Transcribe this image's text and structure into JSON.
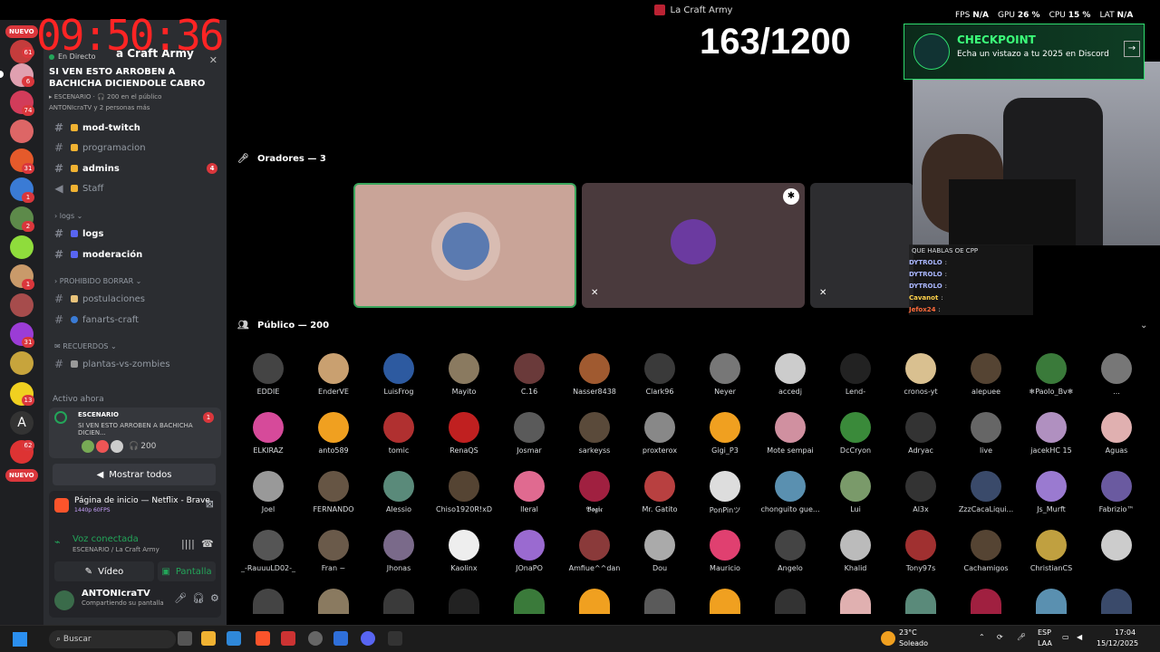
{
  "window": {
    "title": "La Craft Army"
  },
  "overlay": {
    "clock": "09:50:36",
    "counter": "163/1200",
    "perf": {
      "fps_label": "FPS",
      "fps": "N/A",
      "gpu_label": "GPU",
      "gpu": "26 %",
      "cpu_label": "CPU",
      "cpu": "15 %",
      "lat_label": "LAT",
      "lat": "N/A"
    },
    "checkpoint": {
      "title": "CHECKPOINT",
      "subtitle": "Echa un vistazo a tu 2025 en Discord"
    },
    "chat": [
      {
        "user": "",
        "msg": "QUE HABLAS OE CPP"
      },
      {
        "user": "DYTROLO",
        "msg": ":"
      },
      {
        "user": "DYTROLO",
        "msg": ":"
      },
      {
        "user": "DYTROLO",
        "msg": ":"
      },
      {
        "user": "Cavanot",
        "msg": ":"
      },
      {
        "user": "Jefox24",
        "msg": ":"
      }
    ]
  },
  "rail": {
    "nuevo_label": "NUEVO",
    "badges": [
      "61",
      "6",
      "74",
      "31",
      "1",
      "2",
      "1",
      "31",
      "13",
      "62"
    ]
  },
  "sidebar": {
    "server_name": "a Craft Army",
    "stage": {
      "live_label": "En Directo",
      "title": "SI VEN ESTO ARROBEN A BACHICHA DICIENDOLE CABRO",
      "meta_stage": "ESCENARIO",
      "meta_public": "200 en el público",
      "meta_people": "ANTONIcraTV y 2 personas más"
    },
    "channels": [
      {
        "name": "mod-twitch",
        "bold": true
      },
      {
        "name": "programacion"
      },
      {
        "name": "admins",
        "bold": true,
        "count": "4"
      },
      {
        "name": "Staff"
      }
    ],
    "cat_logs": "logs",
    "channels_logs": [
      {
        "name": "logs"
      },
      {
        "name": "moderación"
      }
    ],
    "cat_prohibido": "PROHIBIDO BORRAR",
    "channels_prohibido": [
      {
        "name": "postulaciones"
      },
      {
        "name": "fanarts-craft"
      }
    ],
    "cat_recuerdos": "RECUERDOS",
    "channels_recuerdos": [
      {
        "name": "plantas-vs-zombies"
      }
    ],
    "active_now_label": "Activo ahora",
    "active_card": {
      "type": "ESCENARIO",
      "title": "SI VEN ESTO ARROBEN A BACHICHA DICIEN...",
      "count": "1",
      "people": "200"
    },
    "show_all": "Mostrar todos",
    "activity": {
      "title": "Página de inicio — Netflix - Brave",
      "sub": "1440p 60FPS"
    },
    "voice": {
      "title": "Voz conectada",
      "sub": "ESCENARIO / La Craft Army"
    },
    "video_label": "Vídeo",
    "screen_label": "Pantalla",
    "user": {
      "name": "ANTONIcraTV",
      "status": "Compartiendo su pantalla"
    }
  },
  "stage": {
    "speakers_label": "Oradores — 3",
    "public_label": "Público — 200",
    "audience": [
      "EDDIE",
      "EnderVE",
      "LuisFrog",
      "Mayito",
      "C.16",
      "Nasser8438",
      "Clark96",
      "Neyer",
      "accedj",
      "Lend-",
      "cronos-yt",
      "alepuee",
      "❄Paolo_Bv❄",
      "...",
      "ELKIRAZ",
      "anto589",
      "tomic",
      "RenaQS",
      "Josmar",
      "sarkeyss",
      "proxterox",
      "Gigi_P3",
      "Mote sempai",
      "DcCryon",
      "Adryac",
      "live",
      "jacekHC 15",
      "Aguas",
      "Joel",
      "FERNANDO",
      "Alessio",
      "Chiso1920R!xD",
      "lleral",
      "𝕭𝖔𝖌𝖎𝖈",
      "Mr. Gatito",
      "PonPinツ",
      "chonguito gue...",
      "Lui",
      "Al3x",
      "ZzzCacaLiqui...",
      "Js_Murft",
      "Fabrizio™",
      "_-RauuuLD02-_",
      "Fran ~",
      "Jhonas",
      "Kaolinx",
      "JOnaPO",
      "Amfiue^^dan",
      "Dou",
      "Mauricio",
      "Angelo",
      "Khalid",
      "Tony97s",
      "Cachamigos",
      "ChristianCS",
      ""
    ]
  },
  "taskbar": {
    "search": "Buscar",
    "weather_temp": "23°C",
    "weather_text": "Soleado",
    "lang1": "ESP",
    "lang2": "LAA",
    "time": "17:04",
    "date": "15/12/2025"
  }
}
